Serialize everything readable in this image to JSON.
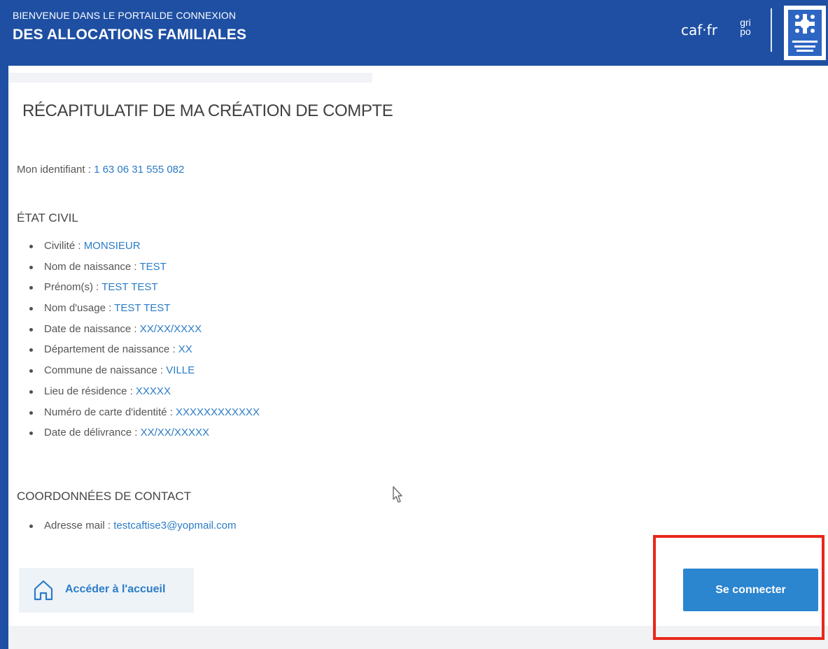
{
  "header": {
    "subtitle": "BIENVENUE DANS LE PORTAILDE CONNEXION",
    "title": "DES ALLOCATIONS FAMILIALES",
    "logo_caf": "caf·fr",
    "logo_grip_top": "gri",
    "logo_grip_bottom": "po",
    "colors": {
      "banner": "#1e4fa3",
      "accent": "#2b7cc7"
    }
  },
  "page_title": "RÉCAPITULATIF DE MA CRÉATION DE COMPTE",
  "identifier": {
    "label": "Mon identifiant : ",
    "value": "1 63 06 31 555 082"
  },
  "etat_civil": {
    "heading": "ÉTAT CIVIL",
    "items": [
      {
        "label": "Civilité : ",
        "value": "MONSIEUR"
      },
      {
        "label": "Nom de naissance : ",
        "value": "TEST"
      },
      {
        "label": "Prénom(s) : ",
        "value": "TEST TEST"
      },
      {
        "label": "Nom d'usage : ",
        "value": "TEST TEST"
      },
      {
        "label": "Date de naissance : ",
        "value": "XX/XX/XXXX"
      },
      {
        "label": "Département de naissance : ",
        "value": "XX"
      },
      {
        "label": "Commune de naissance : ",
        "value": "VILLE"
      },
      {
        "label": "Lieu de résidence : ",
        "value": "XXXXX"
      },
      {
        "label": "Numéro de carte d'identité : ",
        "value": "XXXXXXXXXXXX"
      },
      {
        "label": "Date de délivrance : ",
        "value": "XX/XX/XXXXX"
      }
    ]
  },
  "contact": {
    "heading": "COORDONNÉES DE CONTACT",
    "items": [
      {
        "label": "Adresse mail : ",
        "value": "testcaftise3@yopmail.com"
      }
    ]
  },
  "actions": {
    "home_label": "Accéder à l'accueil",
    "connect_label": "Se connecter",
    "highlight_color": "#e8271c"
  },
  "icons": {
    "home": "home-icon",
    "cursor": "mouse-pointer-icon",
    "logo": "caf-emblem-icon"
  }
}
